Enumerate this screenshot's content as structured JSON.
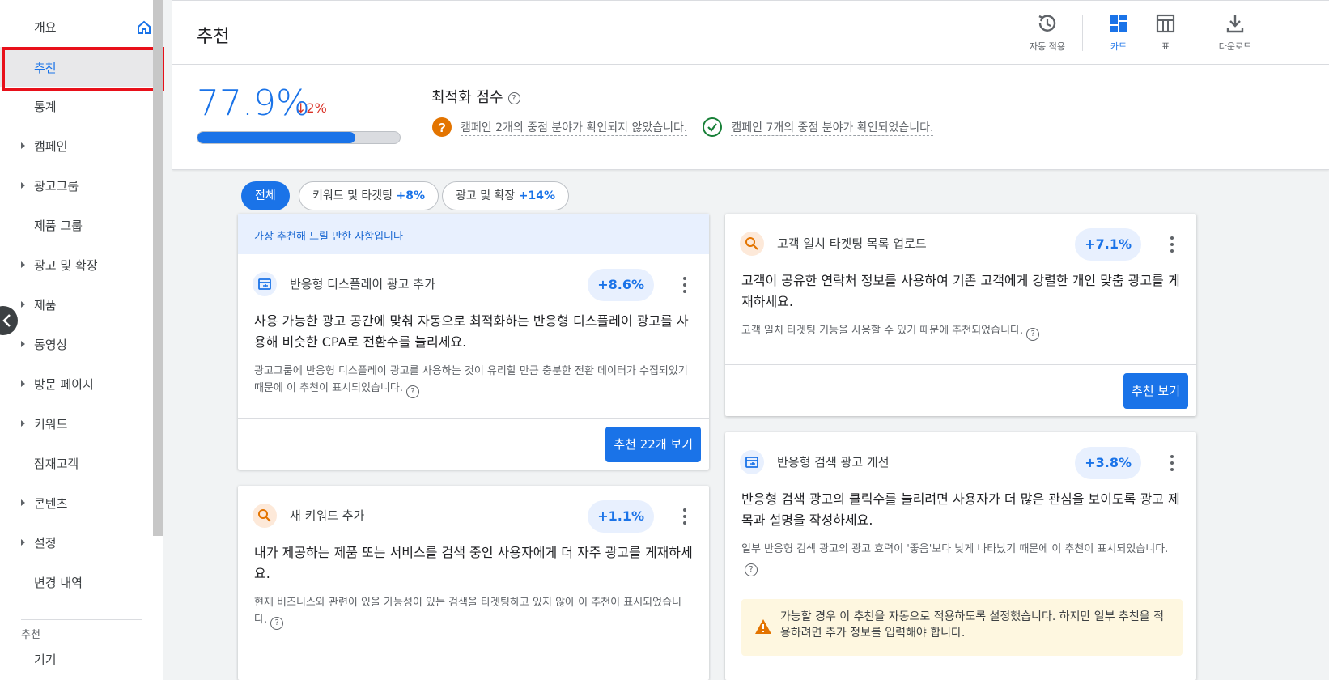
{
  "sidebar": {
    "items": [
      {
        "label": "개요",
        "expandable": false
      },
      {
        "label": "추천",
        "expandable": false,
        "active": true
      },
      {
        "label": "통계",
        "expandable": false
      },
      {
        "label": "캠페인",
        "expandable": true
      },
      {
        "label": "광고그룹",
        "expandable": true
      },
      {
        "label": "제품 그룹",
        "expandable": false
      },
      {
        "label": "광고 및 확장",
        "expandable": true
      },
      {
        "label": "제품",
        "expandable": true
      },
      {
        "label": "동영상",
        "expandable": true
      },
      {
        "label": "방문 페이지",
        "expandable": true
      },
      {
        "label": "키워드",
        "expandable": true
      },
      {
        "label": "잠재고객",
        "expandable": false
      },
      {
        "label": "콘텐츠",
        "expandable": true
      },
      {
        "label": "설정",
        "expandable": true
      },
      {
        "label": "변경 내역",
        "expandable": false
      }
    ],
    "section_label": "추천",
    "section_item": "기기"
  },
  "header": {
    "title": "추천",
    "tools": {
      "auto_apply": "자동 적용",
      "cards": "카드",
      "table": "표",
      "download": "다운로드"
    }
  },
  "score": {
    "value": "77.9%",
    "delta": "2%",
    "progress": 0.779,
    "title": "최적화 점수",
    "unconfirmed": "캠페인 2개의 중점 분야가 확인되지 않았습니다.",
    "confirmed": "캠페인 7개의 중점 분야가 확인되었습니다."
  },
  "filters": {
    "all": "전체",
    "keywords": "키워드 및 타겟팅",
    "keywords_gain": "+8%",
    "ads": "광고 및 확장",
    "ads_gain": "+14%"
  },
  "cards": {
    "top_banner": "가장 추천해 드릴 만한 사항입니다",
    "responsive_display": {
      "title": "반응형 디스플레이 광고 추가",
      "gain": "+8.6%",
      "body": "사용 가능한 광고 공간에 맞춰 자동으로 최적화하는 반응형 디스플레이 광고를 사용해 비슷한 CPA로 전환수를 늘리세요.",
      "reason": "광고그룹에 반응형 디스플레이 광고를 사용하는 것이 유리할 만큼 충분한 전환 데이터가 수집되었기 때문에 이 추천이 표시되었습니다.",
      "button": "추천 22개 보기"
    },
    "new_keywords": {
      "title": "새 키워드 추가",
      "gain": "+1.1%",
      "body": "내가 제공하는 제품 또는 서비스를 검색 중인 사용자에게 더 자주 광고를 게재하세요.",
      "reason": "현재 비즈니스와 관련이 있을 가능성이 있는 검색을 타겟팅하고 있지 않아 이 추천이 표시되었습니다."
    },
    "customer_match": {
      "title": "고객 일치 타겟팅 목록 업로드",
      "gain": "+7.1%",
      "body": "고객이 공유한 연락처 정보를 사용하여 기존 고객에게 강렬한 개인 맞춤 광고를 게재하세요.",
      "reason": "고객 일치 타겟팅 기능을 사용할 수 있기 때문에 추천되었습니다.",
      "button": "추천 보기"
    },
    "responsive_search": {
      "title": "반응형 검색 광고 개선",
      "gain": "+3.8%",
      "body": "반응형 검색 광고의 클릭수를 늘리려면 사용자가 더 많은 관심을 보이도록 광고 제목과 설명을 작성하세요.",
      "reason": "일부 반응형 검색 광고의 광고 효력이 '좋음'보다 낮게 나타났기 때문에 이 추천이 표시되었습니다.",
      "warning": "가능할 경우 이 추천을 자동으로 적용하도록 설정했습니다. 하지만 일부 추천을 적용하려면 추가 정보를 입력해야 합니다."
    }
  },
  "colors": {
    "accent": "#1a73e8",
    "highlight": "#e8101a",
    "down": "#d93025",
    "warning_icon": "#e37400",
    "check_icon": "#188038"
  }
}
